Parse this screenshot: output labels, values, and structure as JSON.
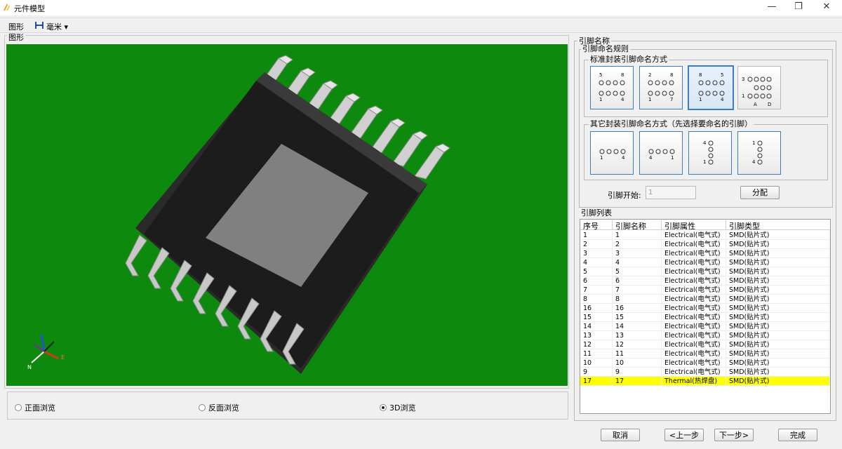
{
  "window": {
    "title": "元件模型",
    "minimize": "—",
    "restore": "❐",
    "close": "✕"
  },
  "toolbar": {
    "graphic": "图形",
    "unit": "毫米"
  },
  "graphic_panel": {
    "label": "图形",
    "axis": {
      "n": "N",
      "e": "E"
    }
  },
  "view_options": [
    {
      "label": "正面浏览",
      "checked": false
    },
    {
      "label": "反面浏览",
      "checked": false
    },
    {
      "label": "3D浏览",
      "checked": true
    }
  ],
  "pin_naming": {
    "group_label": "引脚名称",
    "rule_label": "引脚命名规则",
    "standard_label": "标准封装引脚命名方式",
    "standard_cards": [
      {
        "top_left": "5",
        "top_right": "8",
        "bottom_left": "1",
        "bottom_right": "4"
      },
      {
        "top_left": "2",
        "top_right": "8",
        "bottom_left": "1",
        "bottom_right": "7"
      },
      {
        "top_left": "8",
        "top_right": "5",
        "bottom_left": "1",
        "bottom_right": "4"
      },
      {
        "top_left": "3",
        "middle_left": "1",
        "bottom_left": "A",
        "bottom_right": "D"
      }
    ],
    "other_label": "其它封装引脚命名方式（先选择要命名的引脚）",
    "other_cards": [
      {
        "bottom_left": "1",
        "bottom_right": "4"
      },
      {
        "bottom_left": "4",
        "bottom_right": "1"
      },
      {
        "top": "4",
        "bottom": "1"
      },
      {
        "top": "1",
        "bottom": "4"
      }
    ],
    "start_label": "引脚开始:",
    "start_value": "1",
    "assign_button": "分配"
  },
  "pin_list": {
    "label": "引脚列表",
    "columns": [
      "序号",
      "引脚名称",
      "引脚属性",
      "引脚类型"
    ],
    "rows": [
      [
        "1",
        "1",
        "Electrical(电气式)",
        "SMD(贴片式)"
      ],
      [
        "2",
        "2",
        "Electrical(电气式)",
        "SMD(贴片式)"
      ],
      [
        "3",
        "3",
        "Electrical(电气式)",
        "SMD(贴片式)"
      ],
      [
        "4",
        "4",
        "Electrical(电气式)",
        "SMD(贴片式)"
      ],
      [
        "5",
        "5",
        "Electrical(电气式)",
        "SMD(贴片式)"
      ],
      [
        "6",
        "6",
        "Electrical(电气式)",
        "SMD(贴片式)"
      ],
      [
        "7",
        "7",
        "Electrical(电气式)",
        "SMD(贴片式)"
      ],
      [
        "8",
        "8",
        "Electrical(电气式)",
        "SMD(贴片式)"
      ],
      [
        "16",
        "16",
        "Electrical(电气式)",
        "SMD(贴片式)"
      ],
      [
        "15",
        "15",
        "Electrical(电气式)",
        "SMD(贴片式)"
      ],
      [
        "14",
        "14",
        "Electrical(电气式)",
        "SMD(贴片式)"
      ],
      [
        "13",
        "13",
        "Electrical(电气式)",
        "SMD(贴片式)"
      ],
      [
        "12",
        "12",
        "Electrical(电气式)",
        "SMD(贴片式)"
      ],
      [
        "11",
        "11",
        "Electrical(电气式)",
        "SMD(贴片式)"
      ],
      [
        "10",
        "10",
        "Electrical(电气式)",
        "SMD(贴片式)"
      ],
      [
        "9",
        "9",
        "Electrical(电气式)",
        "SMD(贴片式)"
      ],
      [
        "17",
        "17",
        "Thermal(热焊盘)",
        "SMD(贴片式)"
      ]
    ],
    "highlight_color": "#ffff00"
  },
  "buttons": {
    "cancel": "取消",
    "prev": "<上一步",
    "next": "下一步>",
    "finish": "完成"
  },
  "colors": {
    "viewport_bg": "#0d8a0d",
    "body_dark": "#1e1e1e",
    "pad_gray": "#808080",
    "lead": "#c8c8c8",
    "selection": "#3a7ebf"
  }
}
